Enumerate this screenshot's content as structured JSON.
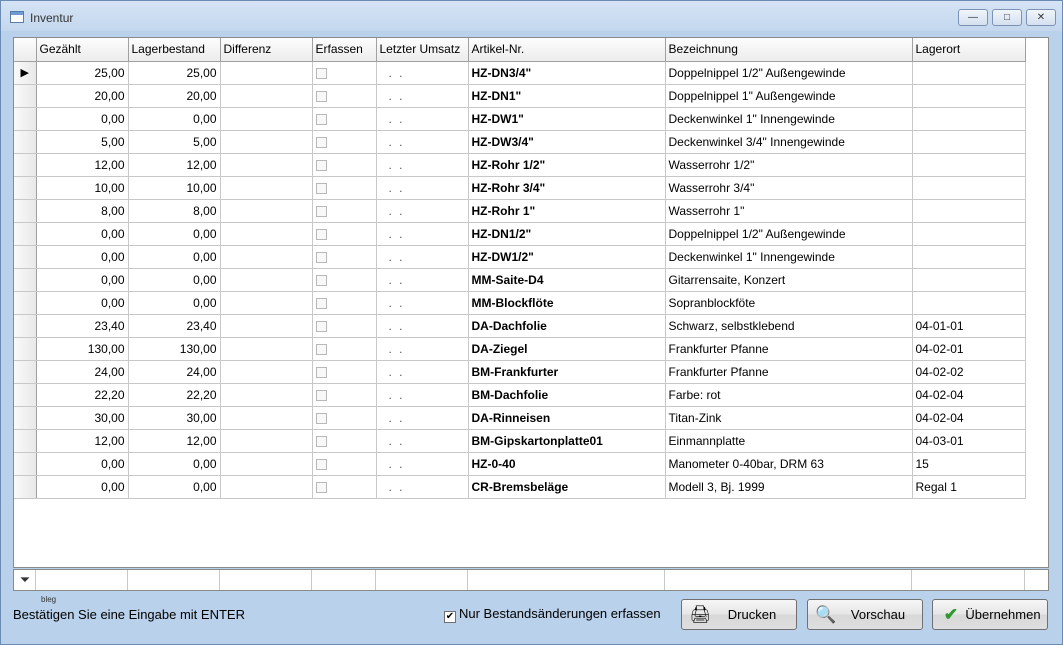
{
  "window": {
    "title": "Inventur"
  },
  "columns": [
    "Gezählt",
    "Lagerbestand",
    "Differenz",
    "Erfassen",
    "Letzter Umsatz",
    "Artikel-Nr.",
    "Bezeichnung",
    "Lagerort"
  ],
  "rows": [
    [
      "25,00",
      "25,00",
      "",
      "",
      ". .",
      "HZ-DN3/4\"",
      "Doppelnippel 1/2\" Außengewinde",
      ""
    ],
    [
      "20,00",
      "20,00",
      "",
      "",
      ". .",
      "HZ-DN1\"",
      "Doppelnippel 1\" Außengewinde",
      ""
    ],
    [
      "0,00",
      "0,00",
      "",
      "",
      ". .",
      "HZ-DW1\"",
      "Deckenwinkel 1\" Innengewinde",
      ""
    ],
    [
      "5,00",
      "5,00",
      "",
      "",
      ". .",
      "HZ-DW3/4\"",
      "Deckenwinkel 3/4\" Innengewinde",
      ""
    ],
    [
      "12,00",
      "12,00",
      "",
      "",
      ". .",
      "HZ-Rohr 1/2\"",
      "Wasserrohr 1/2\"",
      ""
    ],
    [
      "10,00",
      "10,00",
      "",
      "",
      ". .",
      "HZ-Rohr 3/4\"",
      "Wasserrohr 3/4\"",
      ""
    ],
    [
      "8,00",
      "8,00",
      "",
      "",
      ". .",
      "HZ-Rohr 1\"",
      "Wasserrohr 1\"",
      ""
    ],
    [
      "0,00",
      "0,00",
      "",
      "",
      ". .",
      "HZ-DN1/2\"",
      "Doppelnippel 1/2\" Außengewinde",
      ""
    ],
    [
      "0,00",
      "0,00",
      "",
      "",
      ". .",
      "HZ-DW1/2\"",
      "Deckenwinkel 1\" Innengewinde",
      ""
    ],
    [
      "0,00",
      "0,00",
      "",
      "",
      ". .",
      "MM-Saite-D4",
      "Gitarrensaite, Konzert",
      ""
    ],
    [
      "0,00",
      "0,00",
      "",
      "",
      ". .",
      "MM-Blockflöte",
      "Sopranblockföte",
      ""
    ],
    [
      "23,40",
      "23,40",
      "",
      "",
      ". .",
      "DA-Dachfolie",
      "Schwarz, selbstklebend",
      "04-01-01"
    ],
    [
      "130,00",
      "130,00",
      "",
      "",
      ". .",
      "DA-Ziegel",
      "Frankfurter Pfanne",
      "04-02-01"
    ],
    [
      "24,00",
      "24,00",
      "",
      "",
      ". .",
      "BM-Frankfurter",
      "Frankfurter Pfanne",
      "04-02-02"
    ],
    [
      "22,20",
      "22,20",
      "",
      "",
      ". .",
      "BM-Dachfolie",
      "Farbe: rot",
      "04-02-04"
    ],
    [
      "30,00",
      "30,00",
      "",
      "",
      ". .",
      "DA-Rinneisen",
      "Titan-Zink",
      "04-02-04"
    ],
    [
      "12,00",
      "12,00",
      "",
      "",
      ". .",
      "BM-Gipskartonplatte01",
      "Einmannplatte",
      "04-03-01"
    ],
    [
      "0,00",
      "0,00",
      "",
      "",
      ". .",
      "HZ-0-40",
      "Manometer 0-40bar, DRM 63",
      "15"
    ],
    [
      "0,00",
      "0,00",
      "",
      "",
      ". .",
      "CR-Bremsbeläge",
      "Modell 3, Bj. 1999",
      "Regal 1"
    ]
  ],
  "current_row_marker": "▶",
  "footer": {
    "tiny_label": "bleg",
    "status": "Bestätigen Sie eine Eingabe mit ENTER",
    "checkbox_label": "Nur Bestandsänderungen erfassen",
    "checkbox_checked": true,
    "btn_print": "Drucken",
    "btn_preview": "Vorschau",
    "btn_apply": "Übernehmen"
  },
  "icons": {
    "filter": "funnel-icon",
    "print": "printer-icon",
    "preview": "magnifier-icon",
    "apply": "checkmark-icon"
  },
  "colors": {
    "apply_check": "#2e9a2e",
    "window_bg": "#b9d1ea"
  }
}
